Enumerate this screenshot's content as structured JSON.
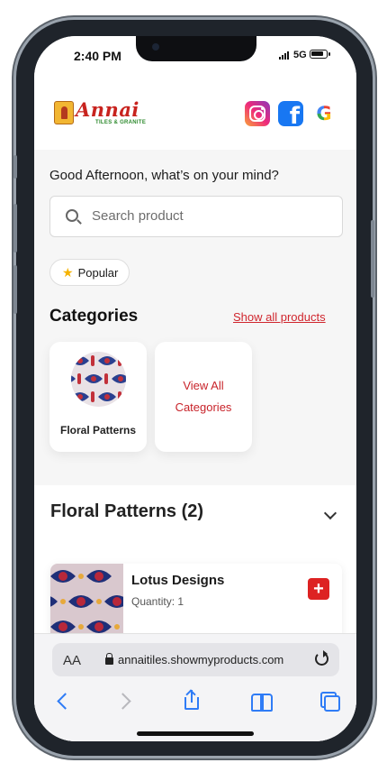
{
  "status": {
    "time": "2:40 PM",
    "network": "5G"
  },
  "brand": {
    "name": "Annai",
    "tagline": "TILES & GRANITE"
  },
  "social": {
    "instagram": "instagram-icon",
    "facebook": "facebook-icon",
    "google": "google-icon",
    "facebook_glyph": "f",
    "google_glyph": "G"
  },
  "greeting": "Good Afternoon, what’s on your mind?",
  "search": {
    "placeholder": "Search product",
    "value": ""
  },
  "chips": [
    {
      "label": "Popular",
      "icon": "star-icon"
    }
  ],
  "categories": {
    "title": "Categories",
    "show_all": "Show all products",
    "items": [
      {
        "label": "Floral Patterns"
      }
    ],
    "view_all": "View All Categories"
  },
  "section": {
    "title": "Floral Patterns (2)",
    "products": [
      {
        "name": "Lotus Designs",
        "quantity": "Quantity: 1"
      }
    ]
  },
  "browser": {
    "text_size": "AA",
    "url": "annaitiles.showmyproducts.com"
  },
  "colors": {
    "accent": "#d0262e",
    "link": "#2f7cf6"
  }
}
